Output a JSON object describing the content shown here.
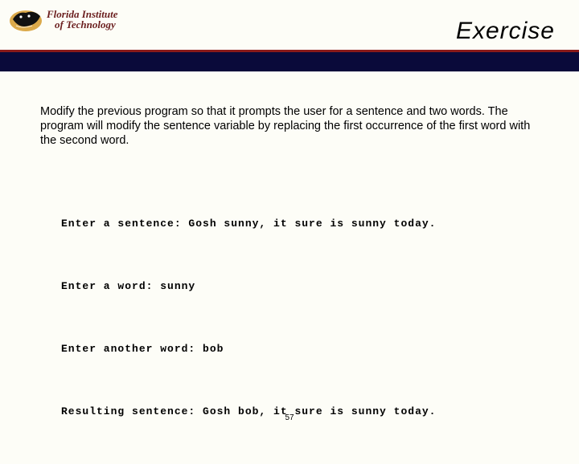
{
  "logo": {
    "line1": "Florida Institute",
    "line2": "of Technology"
  },
  "title": "Exercise",
  "description": "Modify the previous program so that it prompts the user for a sentence and two words. The program will modify the sentence variable by replacing the first occurrence of the first word with the second word.",
  "code_lines": [
    "Enter a sentence: Gosh sunny, it sure is sunny today.",
    "Enter a word: sunny",
    "Enter another word: bob",
    "Resulting sentence: Gosh bob, it sure is sunny today."
  ],
  "page_number": "57"
}
